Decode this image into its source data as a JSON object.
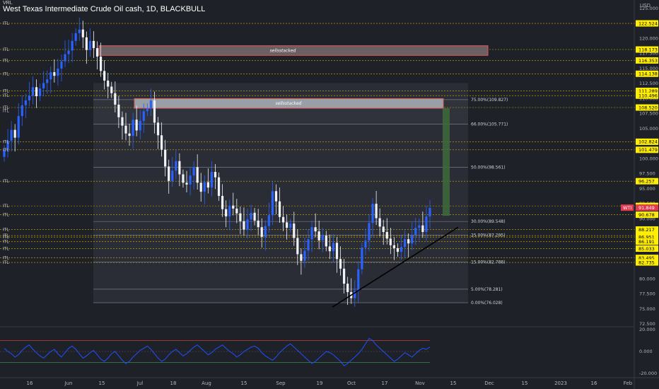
{
  "header": {
    "corner_label": "VRL",
    "title": "West Texas Intermediate Crude Oil cash, 1D, BLACKBULL",
    "currency": "USD"
  },
  "colors": {
    "background": "#1e2128",
    "up_candle": "#2962ff",
    "down_candle": "#f0f3fa",
    "level_line": "#d4b300",
    "level_tag": "#ffee00",
    "fib_line": "#787b86",
    "supply_box": "#e05a5a",
    "target_box": "#3d6b3a",
    "rsi_line": "#2050ff",
    "rsi_upper": "#c83c3c",
    "rsi_lower": "#3c8c46",
    "trendline": "#000000",
    "current_price_tag": "#e53950"
  },
  "price_axis": {
    "ticks": [
      "125.000",
      "122.500",
      "120.000",
      "117.500",
      "115.000",
      "112.500",
      "110.000",
      "107.500",
      "105.000",
      "102.500",
      "100.000",
      "97.500",
      "95.000",
      "92.500",
      "90.000",
      "87.500",
      "85.000",
      "82.500",
      "80.000",
      "77.500",
      "75.000",
      "72.500"
    ],
    "range": [
      72.0,
      126.0
    ]
  },
  "level_tags": [
    "122.524",
    "118.173",
    "116.353",
    "114.138",
    "111.289",
    "110.496",
    "108.520",
    "102.824",
    "101.479",
    "96.257",
    "92.143",
    "90.678",
    "88.217",
    "87.204",
    "86.951",
    "86.191",
    "85.033",
    "83.495",
    "82.735"
  ],
  "current_price": {
    "symbol": "WTI",
    "value": "91.849"
  },
  "left_labels": [
    "ITL",
    "ITL",
    "ITL",
    "ITL",
    "ITL",
    "ITL",
    "ITL",
    "ITL",
    "ITL",
    "ITL",
    "ITL",
    "ITL",
    "ITL",
    "ITL",
    "ITL",
    "ITL",
    "ITL",
    "ITL",
    "ITL",
    "ITL"
  ],
  "boxes": [
    {
      "label": "sellsstacked"
    },
    {
      "label": "sellsstacked"
    }
  ],
  "fib_levels": [
    {
      "label": "75.00%(109.827)",
      "price": 109.827
    },
    {
      "label": "66.00%(105.771)",
      "price": 105.771
    },
    {
      "label": "50.00%(98.561)",
      "price": 98.561
    },
    {
      "label": "30.00%(89.548)",
      "price": 89.548
    },
    {
      "label": "25.00%(87.295)",
      "price": 87.295
    },
    {
      "label": "15.00%(82.788)",
      "price": 82.788
    },
    {
      "label": "5.00%(78.281)",
      "price": 78.281
    },
    {
      "label": "0.00%(76.028)",
      "price": 76.028
    }
  ],
  "rsi_axis": {
    "ticks": [
      "20.000",
      "0.000",
      "-20.000"
    ]
  },
  "time_axis": {
    "ticks": [
      "16",
      "Jun",
      "15",
      "Jul",
      "18",
      "Aug",
      "15",
      "Sep",
      "19",
      "Oct",
      "17",
      "Nov",
      "15",
      "Dec",
      "15",
      "2023",
      "16",
      "Feb"
    ]
  },
  "chart_data": {
    "type": "candlestick",
    "title": "West Texas Intermediate Crude Oil cash, 1D, BLACKBULL",
    "closes": [
      101.5,
      103.0,
      104.8,
      103.5,
      107.1,
      108.9,
      109.7,
      110.5,
      111.9,
      110.4,
      111.7,
      112.6,
      113.2,
      114.4,
      113.8,
      115.0,
      116.2,
      117.4,
      118.0,
      119.6,
      120.9,
      121.5,
      120.2,
      118.1,
      119.6,
      118.4,
      117.0,
      114.6,
      113.0,
      112.0,
      110.9,
      109.0,
      106.9,
      105.5,
      104.2,
      103.8,
      106.5,
      104.7,
      106.3,
      107.9,
      108.4,
      109.7,
      106.0,
      103.9,
      101.5,
      98.7,
      96.3,
      98.0,
      99.6,
      97.4,
      96.0,
      95.7,
      97.2,
      98.6,
      96.0,
      94.5,
      96.1,
      95.2,
      97.8,
      96.9,
      93.8,
      91.6,
      90.4,
      92.2,
      91.7,
      90.9,
      89.6,
      88.2,
      89.9,
      91.0,
      89.7,
      88.6,
      87.0,
      88.8,
      90.6,
      94.6,
      92.9,
      90.3,
      89.4,
      88.5,
      89.2,
      86.8,
      84.1,
      83.0,
      84.7,
      86.6,
      88.6,
      87.9,
      86.4,
      87.2,
      85.4,
      84.6,
      86.0,
      83.3,
      81.7,
      79.2,
      77.8,
      76.8,
      78.0,
      81.6,
      85.2,
      86.4,
      89.3,
      92.5,
      90.1,
      88.7,
      87.8,
      86.7,
      85.6,
      85.1,
      84.5,
      85.3,
      86.6,
      85.9,
      87.3,
      88.5,
      88.9,
      87.8,
      90.4,
      91.8
    ],
    "series": [
      {
        "name": "WTI",
        "last": 91.849
      }
    ],
    "horizontal_levels": [
      122.524,
      118.173,
      116.353,
      114.138,
      111.289,
      110.496,
      108.52,
      102.824,
      101.479,
      96.257,
      92.143,
      90.678,
      88.217,
      87.204,
      86.951,
      86.191,
      85.033,
      83.495,
      82.735
    ],
    "rsi": {
      "upper_band": 10,
      "lower_band": -10,
      "values": [
        3,
        0,
        -2,
        -5,
        -3,
        1,
        4,
        6,
        2,
        -1,
        -4,
        -6,
        -3,
        0,
        2,
        -2,
        -5,
        -1,
        3,
        5,
        2,
        -2,
        -6,
        -4,
        -1,
        1,
        -3,
        -7,
        -9,
        -6,
        -2,
        0,
        -4,
        -8,
        -11,
        -9,
        -5,
        -2,
        1,
        3,
        5,
        2,
        -2,
        -6,
        -9,
        -7,
        -3,
        0,
        2,
        -1,
        -4,
        -2,
        1,
        4,
        6,
        3,
        0,
        -3,
        -1,
        2,
        4,
        6,
        3,
        0,
        -2,
        -5,
        -3,
        0,
        2,
        4,
        5,
        3,
        -1,
        -4,
        -6,
        -8,
        -5,
        -1,
        2,
        5,
        7,
        4,
        1,
        -2,
        -5,
        -8,
        -11,
        -9,
        -6,
        -3,
        0,
        -1,
        -3,
        -6,
        -9,
        -13,
        -11,
        -8,
        -5,
        -2,
        2,
        7,
        12,
        10,
        6,
        3,
        0,
        -3,
        -6,
        -9,
        -7,
        -4,
        -1,
        -3,
        -5,
        -2,
        1,
        3,
        2,
        4
      ]
    }
  }
}
